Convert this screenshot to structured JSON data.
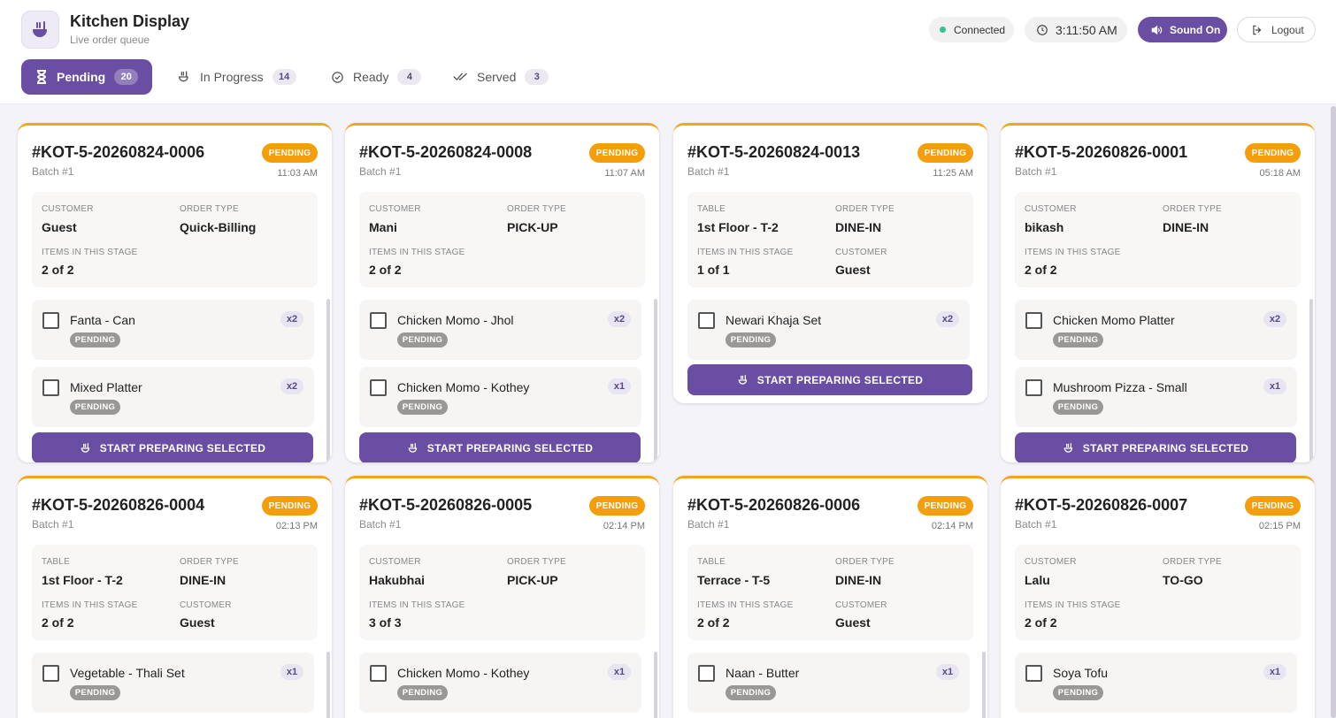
{
  "header": {
    "title": "Kitchen Display",
    "subtitle": "Live order queue",
    "status": "Connected",
    "clock": "3:11:50 AM",
    "sound": "Sound On",
    "logout": "Logout"
  },
  "tabs": [
    {
      "label": "Pending",
      "count": "20"
    },
    {
      "label": "In Progress",
      "count": "14"
    },
    {
      "label": "Ready",
      "count": "4"
    },
    {
      "label": "Served",
      "count": "3"
    }
  ],
  "status_label": "PENDING",
  "start_label": "START PREPARING SELECTED",
  "cards": [
    {
      "kot": "#KOT-5-20260824-0006",
      "batch": "Batch #1",
      "time": "11:03 AM",
      "f1_label": "CUSTOMER",
      "f1_value": "Guest",
      "f2_label": "ORDER TYPE",
      "f2_value": "Quick-Billing",
      "f3_label": "ITEMS IN THIS STAGE",
      "f3_value": "2 of 2",
      "f4_label": "",
      "f4_value": "",
      "items": [
        {
          "name": "Fanta - Can",
          "qty": "x2"
        },
        {
          "name": "Mixed Platter",
          "qty": "x2"
        }
      ]
    },
    {
      "kot": "#KOT-5-20260824-0008",
      "batch": "Batch #1",
      "time": "11:07 AM",
      "f1_label": "CUSTOMER",
      "f1_value": "Mani",
      "f2_label": "ORDER TYPE",
      "f2_value": "PICK-UP",
      "f3_label": "ITEMS IN THIS STAGE",
      "f3_value": "2 of 2",
      "f4_label": "",
      "f4_value": "",
      "items": [
        {
          "name": "Chicken Momo - Jhol",
          "qty": "x2"
        },
        {
          "name": "Chicken Momo - Kothey",
          "qty": "x1"
        }
      ]
    },
    {
      "kot": "#KOT-5-20260824-0013",
      "batch": "Batch #1",
      "time": "11:25 AM",
      "f1_label": "TABLE",
      "f1_value": "1st Floor - T-2",
      "f2_label": "ORDER TYPE",
      "f2_value": "DINE-IN",
      "f3_label": "ITEMS IN THIS STAGE",
      "f3_value": "1 of 1",
      "f4_label": "CUSTOMER",
      "f4_value": "Guest",
      "items": [
        {
          "name": "Newari Khaja Set",
          "qty": "x2"
        }
      ]
    },
    {
      "kot": "#KOT-5-20260826-0001",
      "batch": "Batch #1",
      "time": "05:18 AM",
      "f1_label": "CUSTOMER",
      "f1_value": "bikash",
      "f2_label": "ORDER TYPE",
      "f2_value": "DINE-IN",
      "f3_label": "ITEMS IN THIS STAGE",
      "f3_value": "2 of 2",
      "f4_label": "",
      "f4_value": "",
      "items": [
        {
          "name": "Chicken Momo Platter",
          "qty": "x2"
        },
        {
          "name": "Mushroom Pizza - Small",
          "qty": "x1"
        }
      ]
    },
    {
      "kot": "#KOT-5-20260826-0004",
      "batch": "Batch #1",
      "time": "02:13 PM",
      "f1_label": "TABLE",
      "f1_value": "1st Floor - T-2",
      "f2_label": "ORDER TYPE",
      "f2_value": "DINE-IN",
      "f3_label": "ITEMS IN THIS STAGE",
      "f3_value": "2 of 2",
      "f4_label": "CUSTOMER",
      "f4_value": "Guest",
      "items": [
        {
          "name": "Vegetable - Thali Set",
          "qty": "x1"
        }
      ]
    },
    {
      "kot": "#KOT-5-20260826-0005",
      "batch": "Batch #1",
      "time": "02:14 PM",
      "f1_label": "CUSTOMER",
      "f1_value": "Hakubhai",
      "f2_label": "ORDER TYPE",
      "f2_value": "PICK-UP",
      "f3_label": "ITEMS IN THIS STAGE",
      "f3_value": "3 of 3",
      "f4_label": "",
      "f4_value": "",
      "items": [
        {
          "name": "Chicken Momo - Kothey",
          "qty": "x1"
        }
      ]
    },
    {
      "kot": "#KOT-5-20260826-0006",
      "batch": "Batch #1",
      "time": "02:14 PM",
      "f1_label": "TABLE",
      "f1_value": "Terrace - T-5",
      "f2_label": "ORDER TYPE",
      "f2_value": "DINE-IN",
      "f3_label": "ITEMS IN THIS STAGE",
      "f3_value": "2 of 2",
      "f4_label": "CUSTOMER",
      "f4_value": "Guest",
      "items": [
        {
          "name": "Naan - Butter",
          "qty": "x1"
        }
      ]
    },
    {
      "kot": "#KOT-5-20260826-0007",
      "batch": "Batch #1",
      "time": "02:15 PM",
      "f1_label": "CUSTOMER",
      "f1_value": "Lalu",
      "f2_label": "ORDER TYPE",
      "f2_value": "TO-GO",
      "f3_label": "ITEMS IN THIS STAGE",
      "f3_value": "2 of 2",
      "f4_label": "",
      "f4_value": "",
      "items": [
        {
          "name": "Soya Tofu",
          "qty": "x1"
        }
      ]
    }
  ]
}
